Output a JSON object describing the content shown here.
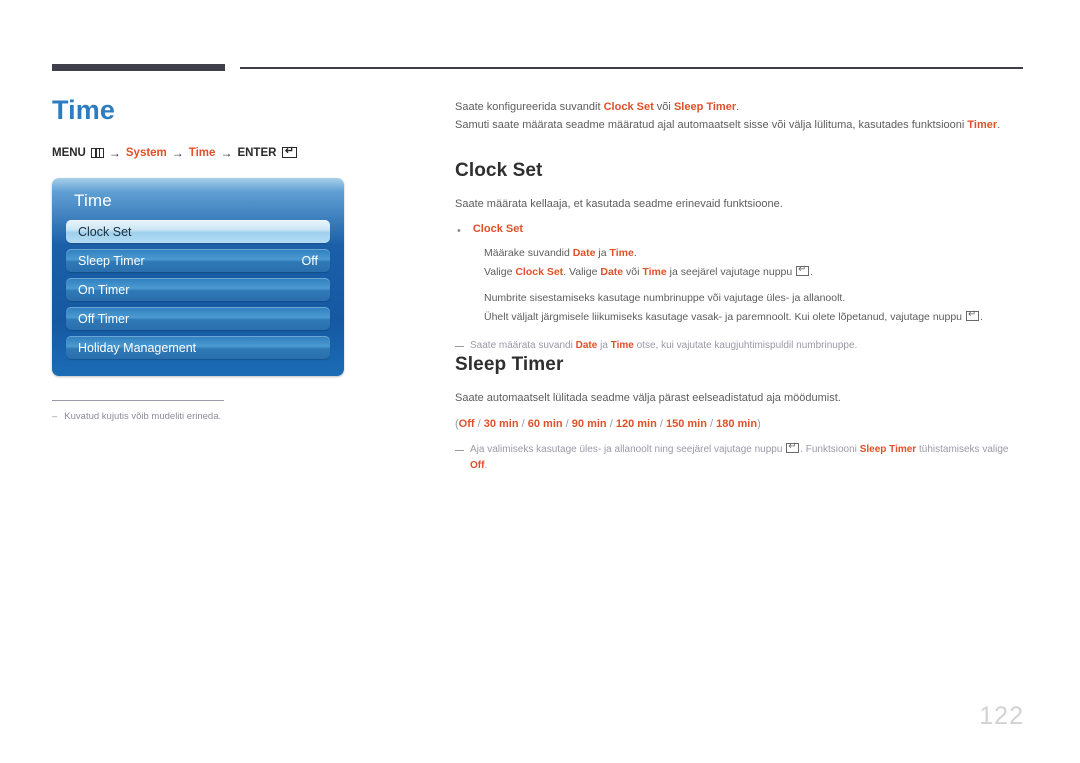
{
  "page_number": "122",
  "header": {
    "title": "Time",
    "breadcrumb": {
      "menu_label": "MENU",
      "menu_icon": "menu-grid-icon",
      "arrow": "→",
      "step1": "System",
      "step2": "Time",
      "enter_label": "ENTER",
      "enter_icon": "enter-return-icon"
    }
  },
  "osd": {
    "title": "Time",
    "rows": [
      {
        "label": "Clock Set",
        "value": "",
        "selected": true
      },
      {
        "label": "Sleep Timer",
        "value": "Off",
        "selected": false
      },
      {
        "label": "On Timer",
        "value": "",
        "selected": false
      },
      {
        "label": "Off Timer",
        "value": "",
        "selected": false
      },
      {
        "label": "Holiday Management",
        "value": "",
        "selected": false
      }
    ]
  },
  "left_footnote": {
    "dash": "–",
    "text": "Kuvatud kujutis võib mudeliti erineda."
  },
  "intro": {
    "line1_a": "Saate konfigureerida suvandit ",
    "line1_hl1": "Clock Set",
    "line1_b": " või ",
    "line1_hl2": "Sleep Timer",
    "line1_c": ".",
    "line2_a": "Samuti saate määrata seadme määratud ajal automaatselt sisse või välja lülituma, kasutades funktsiooni ",
    "line2_hl": "Timer",
    "line2_b": "."
  },
  "clock_set": {
    "heading": "Clock Set",
    "description": "Saate määrata kellaaja, et kasutada seadme erinevaid funktsioone.",
    "bullet_label": "Clock Set",
    "bullet_dot": "•",
    "sub": {
      "l1_a": "Määrake suvandid ",
      "l1_hl1": "Date",
      "l1_b": " ja ",
      "l1_hl2": "Time",
      "l1_c": ".",
      "l2_a": "Valige ",
      "l2_hl1": "Clock Set",
      "l2_b": ". Valige ",
      "l2_hl2": "Date",
      "l2_c": " või ",
      "l2_hl3": "Time",
      "l2_d": " ja seejärel vajutage nuppu ",
      "l2_e": ".",
      "l3": "Numbrite sisestamiseks kasutage numbrinuppe või vajutage üles- ja allanoolt.",
      "l4_a": "Ühelt väljalt järgmisele liikumiseks kasutage vasak- ja paremnoolt. Kui olete lõpetanud, vajutage nuppu ",
      "l4_b": "."
    },
    "note": {
      "a": "Saate määrata suvandi ",
      "hl1": "Date",
      "b": " ja ",
      "hl2": "Time",
      "c": " otse, kui vajutate kaugjuhtimispuldil numbrinuppe."
    }
  },
  "sleep_timer": {
    "heading": "Sleep Timer",
    "description": "Saate automaatselt lülitada seadme välja pärast eelseadistatud aja möödumist.",
    "options_open": "(",
    "options": [
      "Off",
      "30 min",
      "60 min",
      "90 min",
      "120 min",
      "150 min",
      "180 min"
    ],
    "options_sep": " / ",
    "options_close": ")",
    "note": {
      "a": "Aja valimiseks kasutage üles- ja allanoolt ning seejärel vajutage nuppu ",
      "b": ". Funktsiooni ",
      "hl1": "Sleep Timer",
      "c": " tühistamiseks valige ",
      "hl2": "Off",
      "d": "."
    }
  }
}
